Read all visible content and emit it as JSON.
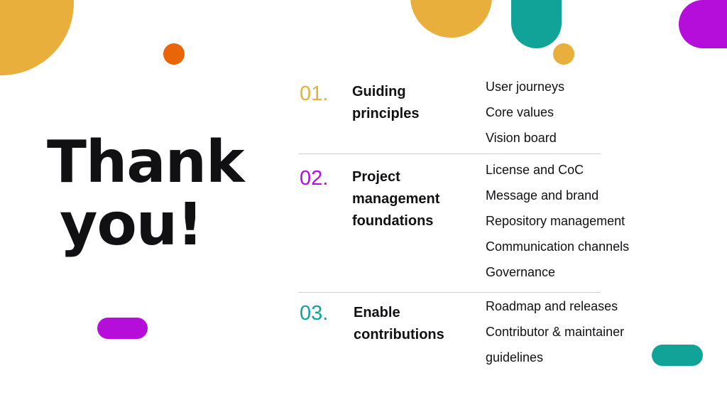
{
  "slide": {
    "heading_line1": "Thank",
    "heading_line2": "you!",
    "colors": {
      "yellow": "#E8AF3D",
      "orange": "#E86508",
      "teal": "#12A398",
      "purple": "#B50DDA",
      "text": "#111114"
    },
    "sections": [
      {
        "number": "01.",
        "number_color": "#E8AF3D",
        "title": "Guiding principles",
        "items": [
          "User journeys",
          "Core values",
          "Vision board"
        ]
      },
      {
        "number": "02.",
        "number_color": "#B50DDA",
        "title": "Project management foundations",
        "items": [
          "License and CoC",
          "Message and brand",
          "Repository management",
          "Communication channels",
          "Governance"
        ]
      },
      {
        "number": "03.",
        "number_color": "#12A398",
        "title": "Enable contributions",
        "items": [
          "Roadmap and releases",
          "Contributor & maintainer",
          "guidelines"
        ]
      }
    ]
  }
}
